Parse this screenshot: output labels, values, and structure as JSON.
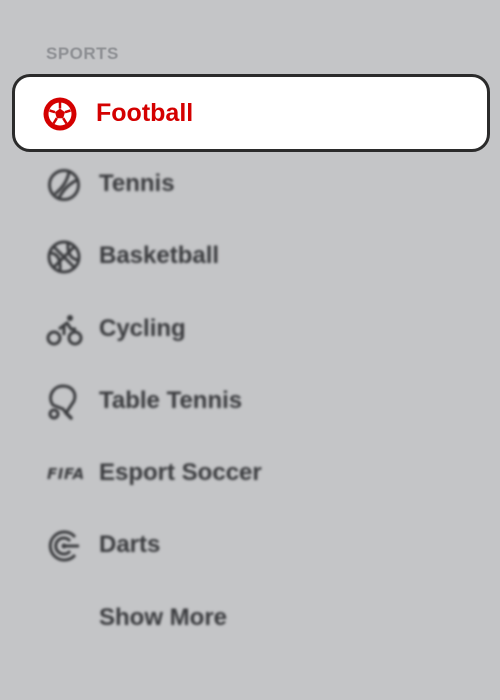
{
  "sidebar": {
    "section_title": "SPORTS",
    "selected": {
      "label": "Football",
      "icon": "soccer-ball-icon",
      "accent_color": "#d40000"
    },
    "items": [
      {
        "label": "Tennis",
        "icon": "tennis-ball-icon"
      },
      {
        "label": "Basketball",
        "icon": "basketball-icon"
      },
      {
        "label": "Cycling",
        "icon": "cyclist-icon"
      },
      {
        "label": "Table Tennis",
        "icon": "ping-pong-paddle-icon"
      },
      {
        "label": "Esport Soccer",
        "icon": "fifa-logo-icon",
        "icon_text": "FIFA"
      },
      {
        "label": "Darts",
        "icon": "dartboard-icon"
      }
    ],
    "show_more_label": "Show More"
  }
}
